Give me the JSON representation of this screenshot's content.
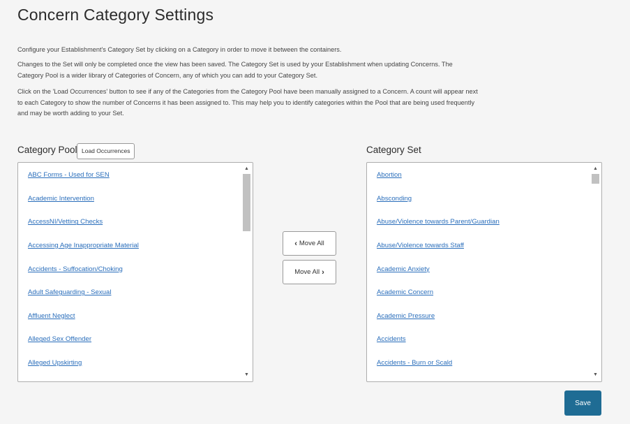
{
  "page": {
    "title": "Concern Category Settings",
    "description_1": "Configure your Establishment's Category Set by clicking on a Category in order to move it between the containers.",
    "description_2": "Changes to the Set will only be completed once the view has been saved. The Category Set is used by your Establishment when updating Concerns. The Category Pool is a wider library of Categories of Concern, any of which you can add to your Category Set.",
    "description_3": "Click on the 'Load Occurrences' button to see if any of the Categories from the Category Pool have been manually assigned to a Concern. A count will appear next to each Category to show the number of Concerns it has been assigned to. This may help you to identify categories within the Pool that are being used frequently and may be worth adding to your Set."
  },
  "pool": {
    "label": "Category Pool",
    "load_button": "Load Occurrences",
    "items": [
      "ABC Forms - Used for SEN",
      "Academic Intervention",
      "AccessNI/Vetting Checks",
      "Accessing Age Inappropriate Material",
      "Accidents - Suffocation/Choking",
      "Adult Safeguarding - Sexual",
      "Affluent Neglect",
      "Alleged Sex Offender",
      "Alleged Upskirting"
    ]
  },
  "set": {
    "label": "Category Set",
    "items": [
      "Abortion",
      "Absconding",
      "Abuse/Violence towards Parent/Guardian",
      "Abuse/Violence towards Staff",
      "Academic Anxiety",
      "Academic Concern",
      "Academic Pressure",
      "Accidents",
      "Accidents - Burn or Scald"
    ]
  },
  "controls": {
    "move_all_left": "Move All",
    "move_all_right": "Move All",
    "left_chevron": "‹",
    "right_chevron": "›",
    "save": "Save",
    "scroll_up": "▲",
    "scroll_down": "▼"
  },
  "colors": {
    "link": "#2a6ebb",
    "save_button": "#1f6c94",
    "background": "#f5f5f5"
  }
}
